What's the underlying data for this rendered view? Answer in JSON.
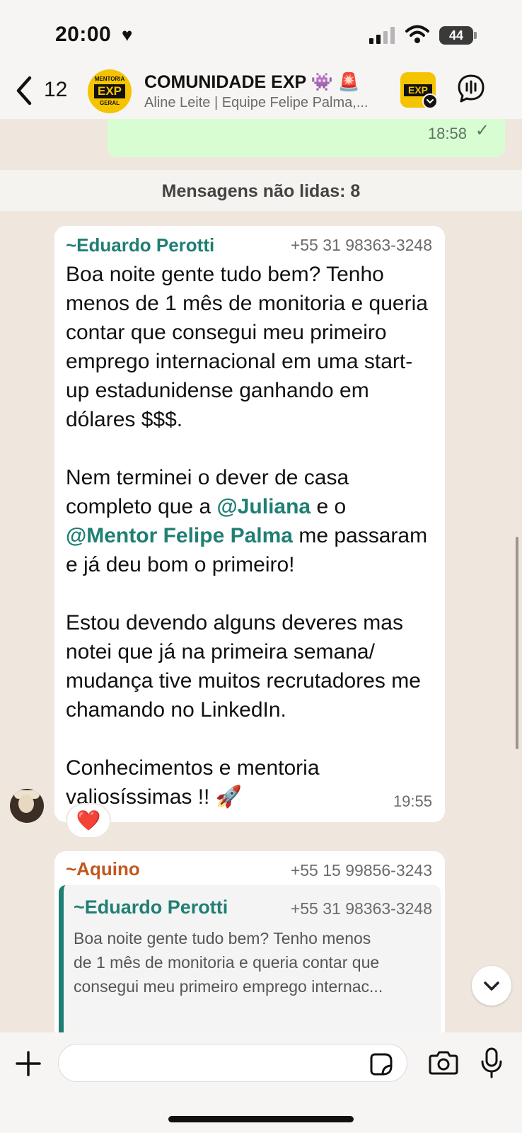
{
  "status_bar": {
    "time": "20:00",
    "battery": "44"
  },
  "header": {
    "back_count": "12",
    "title": "COMUNIDADE EXP 👾 🚨",
    "subtitle": "Aline Leite | Equipe Felipe Palma,...",
    "avatar_top": "MENTORIA",
    "avatar_main": "EXP",
    "avatar_bottom": "GERAL"
  },
  "outgoing_message": {
    "time": "18:58"
  },
  "unread_banner": "Mensagens não lidas: 8",
  "message_1": {
    "sender": "~Eduardo Perotti",
    "phone": "+55 31 98363-3248",
    "paragraph_1": "Boa noite gente tudo bem? Tenho menos de 1 mês de monitoria e queria contar que consegui meu primeiro emprego internacional em uma start-up estadunidense ganhando em dólares $$$.",
    "p2_a": "Nem terminei o dever de casa completo que a ",
    "p2_mention_1": "@Juliana",
    "p2_b": " e o ",
    "p2_mention_2": "@Mentor Felipe Palma",
    "p2_c": " me passaram e já deu bom o primeiro!",
    "paragraph_3": "Estou devendo alguns deveres mas notei que já na primeira semana/ mudança tive muitos recrutadores me chamando no LinkedIn.",
    "paragraph_4": "Conhecimentos e mentoria valiosíssimas !! 🚀",
    "time": "19:55",
    "reaction": "❤️"
  },
  "message_2": {
    "sender": "~Aquino",
    "phone": "+55 15 99856-3243",
    "quote": {
      "sender": "~Eduardo Perotti",
      "phone": "+55 31 98363-3248",
      "line_1": "Boa noite gente tudo bem? Tenho menos",
      "line_2": "de 1 mês de monitoria e queria contar que",
      "line_3": "consegui meu  primeiro emprego internac..."
    }
  },
  "colors": {
    "sender_teal": "#1f7f73",
    "sender_orange": "#c2571d",
    "outgoing_bubble": "#d9fdd3",
    "chat_bg": "#efe7de",
    "brand_yellow": "#f5c400"
  },
  "icons": [
    "heart-icon",
    "signal-icon",
    "wifi-icon",
    "back-chevron-icon",
    "voice-chat-icon",
    "check-icon",
    "chevron-down-icon",
    "plus-icon",
    "sticker-icon",
    "camera-icon",
    "mic-icon"
  ]
}
